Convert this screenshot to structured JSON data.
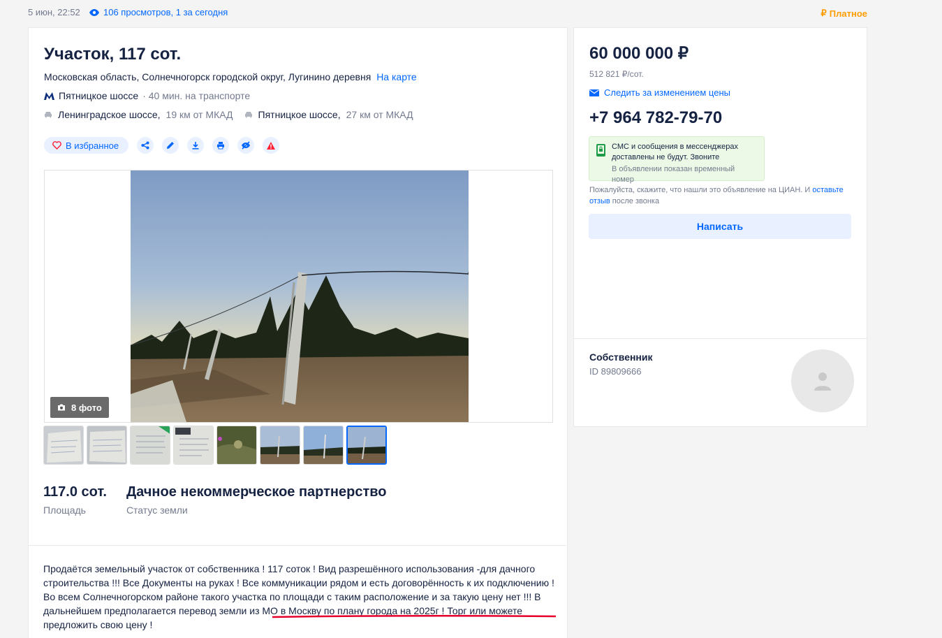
{
  "meta": {
    "date": "5 июн, 22:52",
    "views": "106 просмотров, 1 за сегодня",
    "paid": "Платное"
  },
  "listing": {
    "title": "Участок, 117 сот.",
    "address": "Московская область, Солнечногорск городской округ, Лугинино деревня",
    "map_link": "На карте",
    "metro_name": "Пятницкое шоссе",
    "metro_time": "· 40 мин. на транспорте",
    "highways": [
      {
        "name": "Ленинградское шоссе,",
        "distance": "19 км от МКАД"
      },
      {
        "name": "Пятницкое шоссе,",
        "distance": "27 км от МКАД"
      }
    ],
    "favorite_label": "В избранное",
    "photo_count": "8 фото",
    "facts": [
      {
        "value": "117.0 сот.",
        "label": "Площадь"
      },
      {
        "value": "Дачное некоммерческое партнерство",
        "label": "Статус земли"
      }
    ],
    "description": "Продаётся земельный участок от собственника ! 117 соток ! Вид разрешённого использования -для дачного строительства !!! Все Документы на руках ! Все коммуникации рядом и есть договорённость к их подключению ! Во всем Солнечногорском районе такого участка по площади с таким расположение и за такую цену нет !!! В дальнейшем предполагается перевод земли из МО в Москву по плану города на 2025г ! Торг или можете предложить свою цену !"
  },
  "sidebar": {
    "price": "60 000 000 ₽",
    "price_per_unit": "512 821 ₽/сот.",
    "follow_price": "Следить за изменением цены",
    "phone": "+7 964 782-79-70",
    "notice_main": "СМС и сообщения в мессенджерах доставлены не будут. Звоните",
    "notice_small": "В объявлении показан временный номер",
    "please_text": "Пожалуйста, скажите, что нашли это объявление на ЦИАН. И",
    "please_link": "оставьте отзыв",
    "please_tail": "после звонка",
    "write_button": "Написать",
    "owner_role": "Собственник",
    "owner_id": "ID 89809666"
  },
  "colors": {
    "accent": "#0468ff",
    "paid": "#ff9d00",
    "alert": "#ff1f34",
    "underline": "#e4002b"
  }
}
